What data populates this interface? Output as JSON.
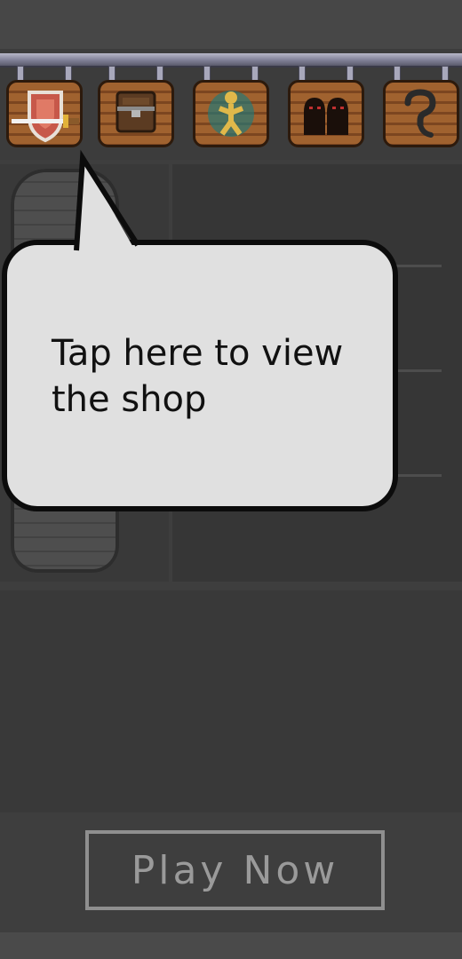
{
  "shop_tabs": [
    {
      "icon": "shield-sword-icon",
      "selected": true
    },
    {
      "icon": "treasure-chest-icon",
      "selected": false
    },
    {
      "icon": "glowing-figure-icon",
      "selected": false
    },
    {
      "icon": "hooded-figures-icon",
      "selected": false
    },
    {
      "icon": "question-mark-icon",
      "selected": false
    }
  ],
  "tooltip": {
    "text": "Tap here to view the shop"
  },
  "play_button": {
    "label": "Play Now"
  },
  "colors": {
    "bubble_fill": "#e0e0e0",
    "bubble_outline": "#0c0c0c",
    "sign_wood": "#a0622f",
    "button_text": "#9a9a9a"
  }
}
